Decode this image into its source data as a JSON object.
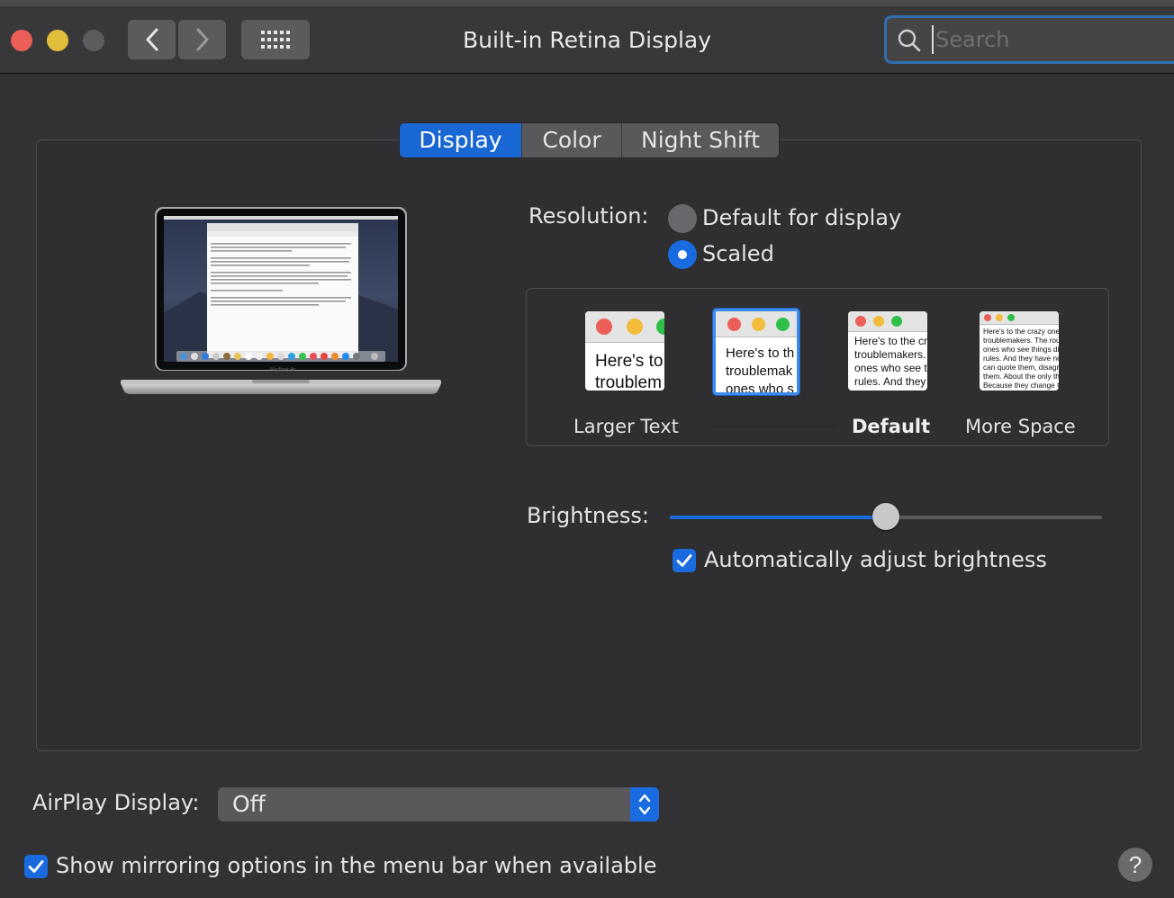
{
  "window": {
    "title": "Built-in Retina Display",
    "traffic_lights": [
      "close",
      "minimize",
      "zoom-disabled"
    ],
    "colors": {
      "close": "#ec5f58",
      "minimize": "#e0bd3b",
      "zoom": "#5c5c5e",
      "accent": "#1a6be0"
    }
  },
  "toolbar": {
    "back_icon": "chevron-left-icon",
    "forward_icon": "chevron-right-icon",
    "grid_icon": "show-all-grid-icon"
  },
  "search": {
    "placeholder": "Search",
    "value": ""
  },
  "tabs": [
    {
      "label": "Display",
      "active": true
    },
    {
      "label": "Color",
      "active": false
    },
    {
      "label": "Night Shift",
      "active": false
    }
  ],
  "display_image": {
    "caption": "MacBook Air"
  },
  "resolution": {
    "label": "Resolution:",
    "options": [
      {
        "label": "Default for display",
        "selected": false
      },
      {
        "label": "Scaled",
        "selected": true
      }
    ]
  },
  "scaling": {
    "previews": [
      {
        "sample": "Here's to\ntroublem"
      },
      {
        "sample": "Here's to th\ntroublemak\nones who s"
      },
      {
        "sample": "Here's to the cr\ntroublemakers.\nones who see t\nrules. And they"
      },
      {
        "sample": "Here's to the crazy one\ntroublemakers. The rou\nones who see things di\nrules. And they have no\ncan quote them, disagre\nthem. About the only th\nBecause they change t"
      }
    ],
    "selected_index": 1,
    "labels": {
      "larger": "Larger Text",
      "default": "Default",
      "more": "More Space"
    }
  },
  "brightness": {
    "label": "Brightness:",
    "value_fraction": 0.5,
    "auto_label": "Automatically adjust brightness",
    "auto_checked": true
  },
  "airplay": {
    "label": "AirPlay Display:",
    "value": "Off"
  },
  "mirroring": {
    "label": "Show mirroring options in the menu bar when available",
    "checked": true
  },
  "help": {
    "label": "?"
  }
}
